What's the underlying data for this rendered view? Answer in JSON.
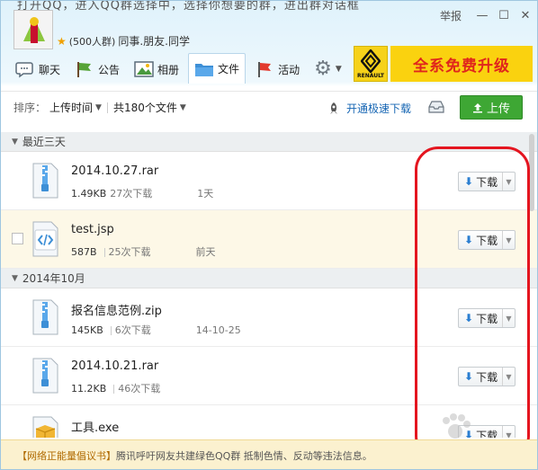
{
  "header": {
    "cut_text": "打开QQ，进入QQ群选择中，选择你想要的群，进出群对话框",
    "report": "举报",
    "group_size": "(500人群)",
    "group_tags": "同事.朋友.同学"
  },
  "tabs": [
    {
      "label": "聊天",
      "icon": "chat-icon"
    },
    {
      "label": "公告",
      "icon": "announcement-flag-icon"
    },
    {
      "label": "相册",
      "icon": "photo-album-icon"
    },
    {
      "label": "文件",
      "icon": "folder-icon",
      "active": true
    },
    {
      "label": "活动",
      "icon": "activity-flag-icon"
    }
  ],
  "ad": {
    "brand": "RENAULT",
    "text": "全系免费升级"
  },
  "toolbar": {
    "sort_label": "排序：",
    "sort_value": "上传时间",
    "file_count": "共180个文件",
    "speed_link": "开通极速下载",
    "upload_label": "上传"
  },
  "sections": [
    {
      "title": "最近三天",
      "files": [
        {
          "name": "2014.10.27.rar",
          "size": "1.49KB",
          "downloads": "27次下载",
          "time": "1天",
          "icon": "zip-archive-icon",
          "download_label": "下载"
        },
        {
          "name": "test.jsp",
          "size": "587B",
          "downloads": "25次下载",
          "time": "前天",
          "icon": "code-file-icon",
          "download_label": "下载",
          "hover": true
        }
      ]
    },
    {
      "title": "2014年10月",
      "files": [
        {
          "name": "报名信息范例.zip",
          "size": "145KB",
          "downloads": "6次下载",
          "time": "14-10-25",
          "icon": "zip-archive-icon",
          "download_label": "下载"
        },
        {
          "name": "2014.10.21.rar",
          "size": "11.2KB",
          "downloads": "46次下载",
          "time": "",
          "icon": "zip-archive-icon",
          "download_label": "下载"
        },
        {
          "name": "工具.exe",
          "size": "",
          "downloads": "",
          "time": "",
          "icon": "package-icon",
          "download_label": "下载"
        }
      ]
    }
  ],
  "notice": {
    "tag": "【网络正能量倡议书】",
    "text": "腾讯呼吁网友共建绿色QQ群 抵制色情、反动等违法信息。"
  },
  "colors": {
    "accent": "#1565b3",
    "upload_green": "#3ea734",
    "annotation_red": "#e4151f",
    "ad_yellow": "#fad20f"
  }
}
